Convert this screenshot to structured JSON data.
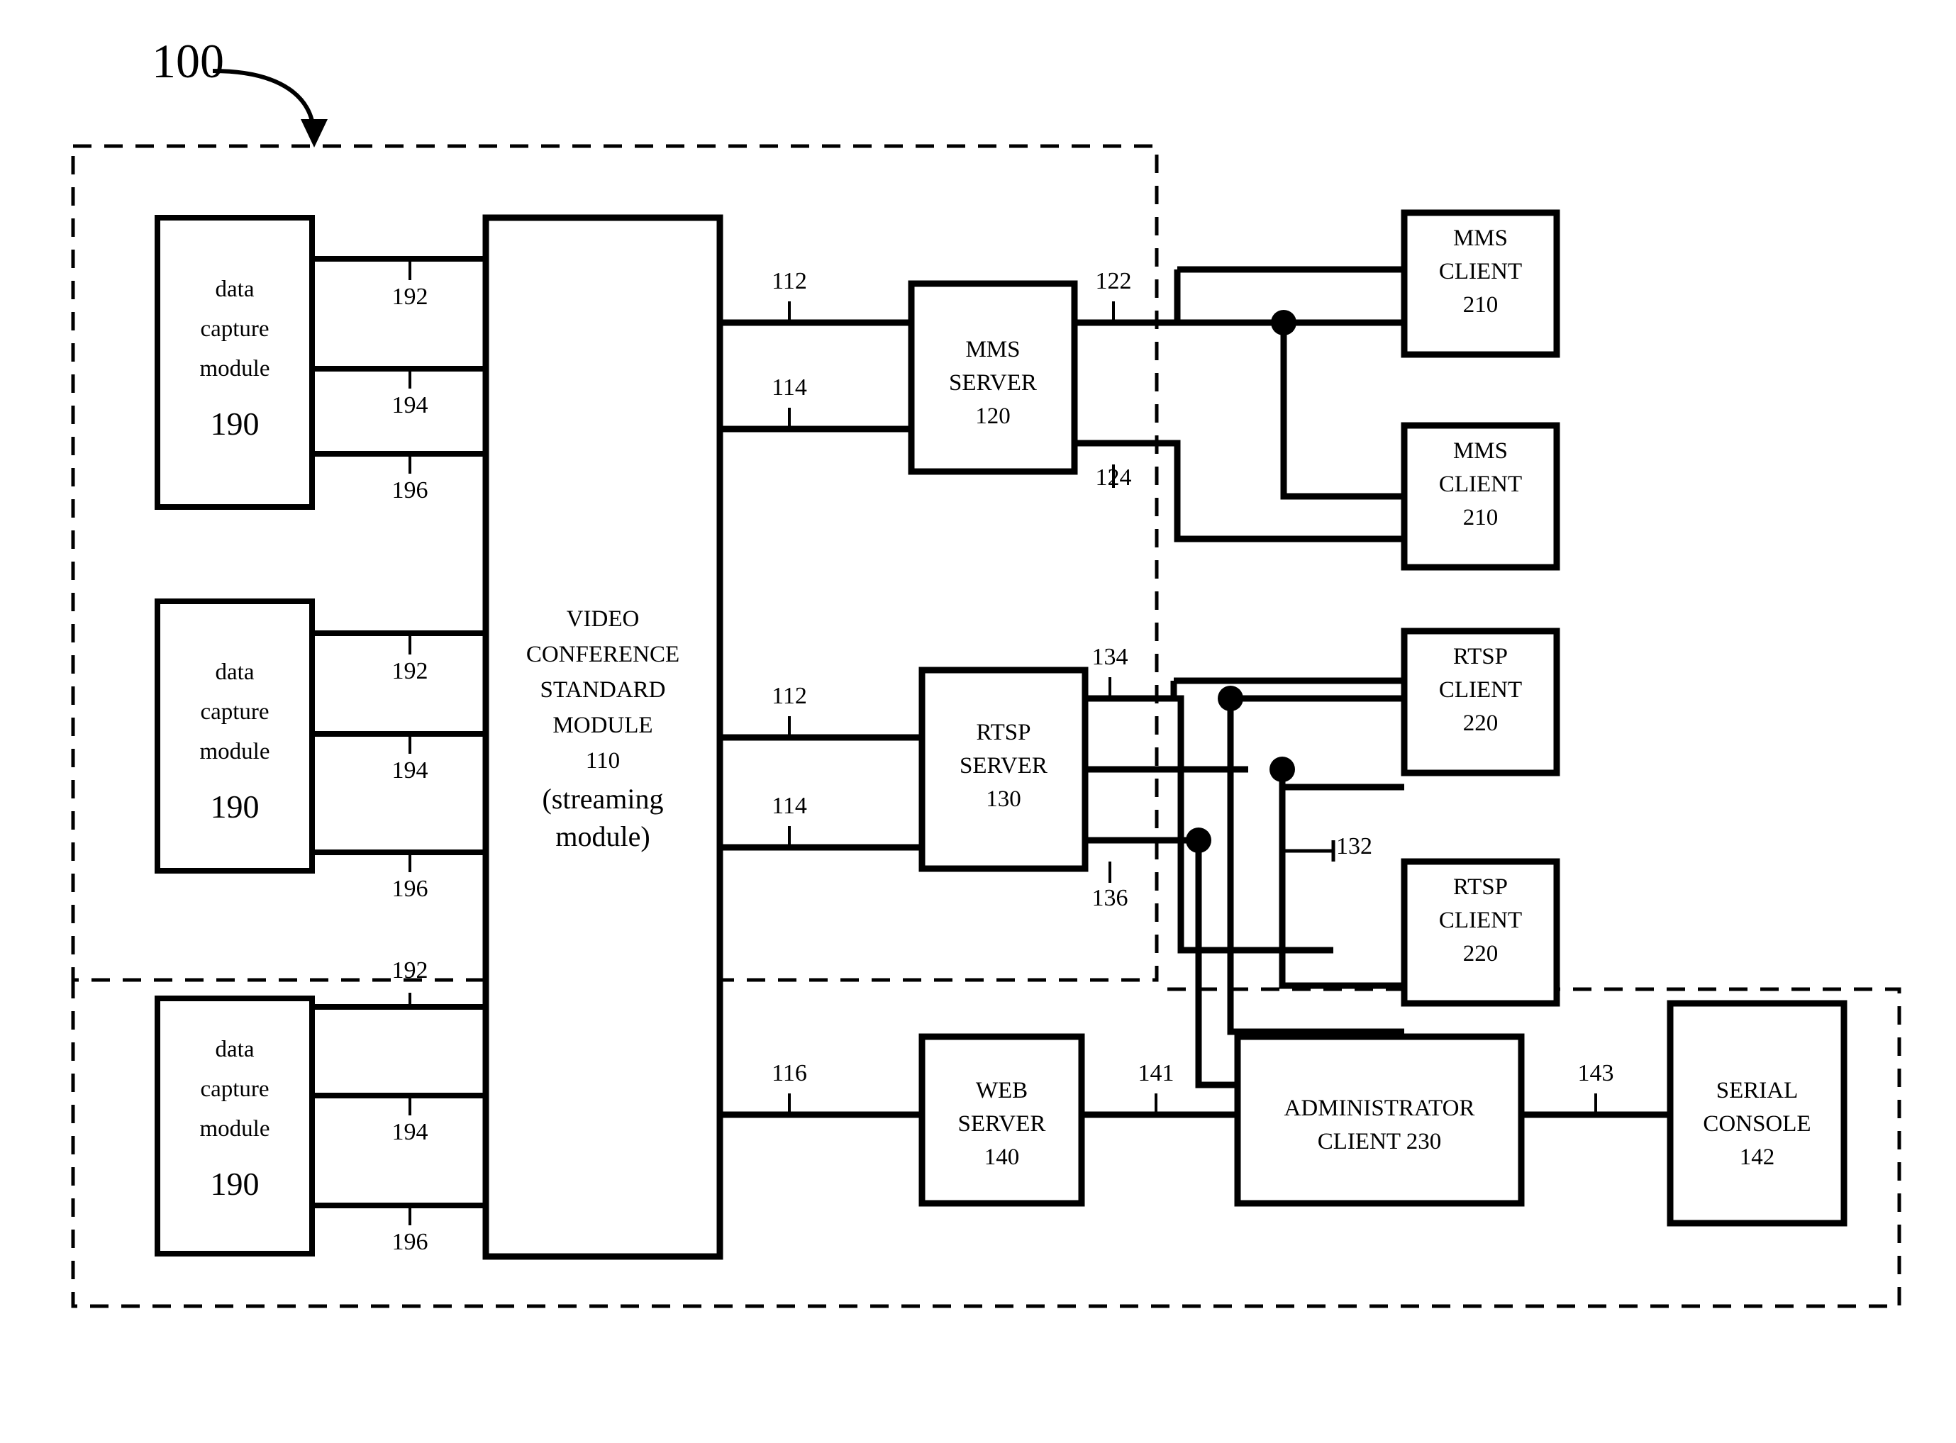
{
  "figure": {
    "number": "100",
    "caption_boxes": {
      "data_capture": {
        "title_line1": "data",
        "title_line2": "capture",
        "title_line3": "module",
        "ref": "190"
      },
      "vcs_module": {
        "line1": "VIDEO",
        "line2": "CONFERENCE",
        "line3": "STANDARD",
        "line4": "MODULE",
        "ref": "110",
        "line5": "(streaming",
        "line6": "module)"
      },
      "mms_server": {
        "line1": "MMS",
        "line2": "SERVER",
        "ref": "120"
      },
      "rtsp_server": {
        "line1": "RTSP",
        "line2": "SERVER",
        "ref": "130"
      },
      "web_server": {
        "line1": "WEB",
        "line2": "SERVER",
        "ref": "140"
      },
      "mms_client": {
        "line1": "MMS",
        "line2": "CLIENT",
        "ref": "210"
      },
      "rtsp_client": {
        "line1": "RTSP",
        "line2": "CLIENT",
        "ref": "220"
      },
      "administrator_client": {
        "line1": "ADMINISTRATOR",
        "line2": "CLIENT 230"
      },
      "serial_console": {
        "line1": "SERIAL",
        "line2": "CONSOLE",
        "ref": "142"
      }
    },
    "connector_refs": {
      "dc1_a": "192",
      "dc1_b": "194",
      "dc1_c": "196",
      "dc2_a": "192",
      "dc2_b": "194",
      "dc2_c": "196",
      "dc3_a": "192",
      "dc3_b": "194",
      "dc3_c": "196",
      "mms_in_a": "112",
      "mms_in_b": "114",
      "mms_out_a": "122",
      "mms_out_b": "124",
      "rtsp_in_a": "112",
      "rtsp_in_b": "114",
      "rtsp_out_a": "134",
      "rtsp_out_b": "136",
      "rtsp_mid": "132",
      "web_in": "116",
      "web_out": "141",
      "admin_out": "143"
    }
  }
}
